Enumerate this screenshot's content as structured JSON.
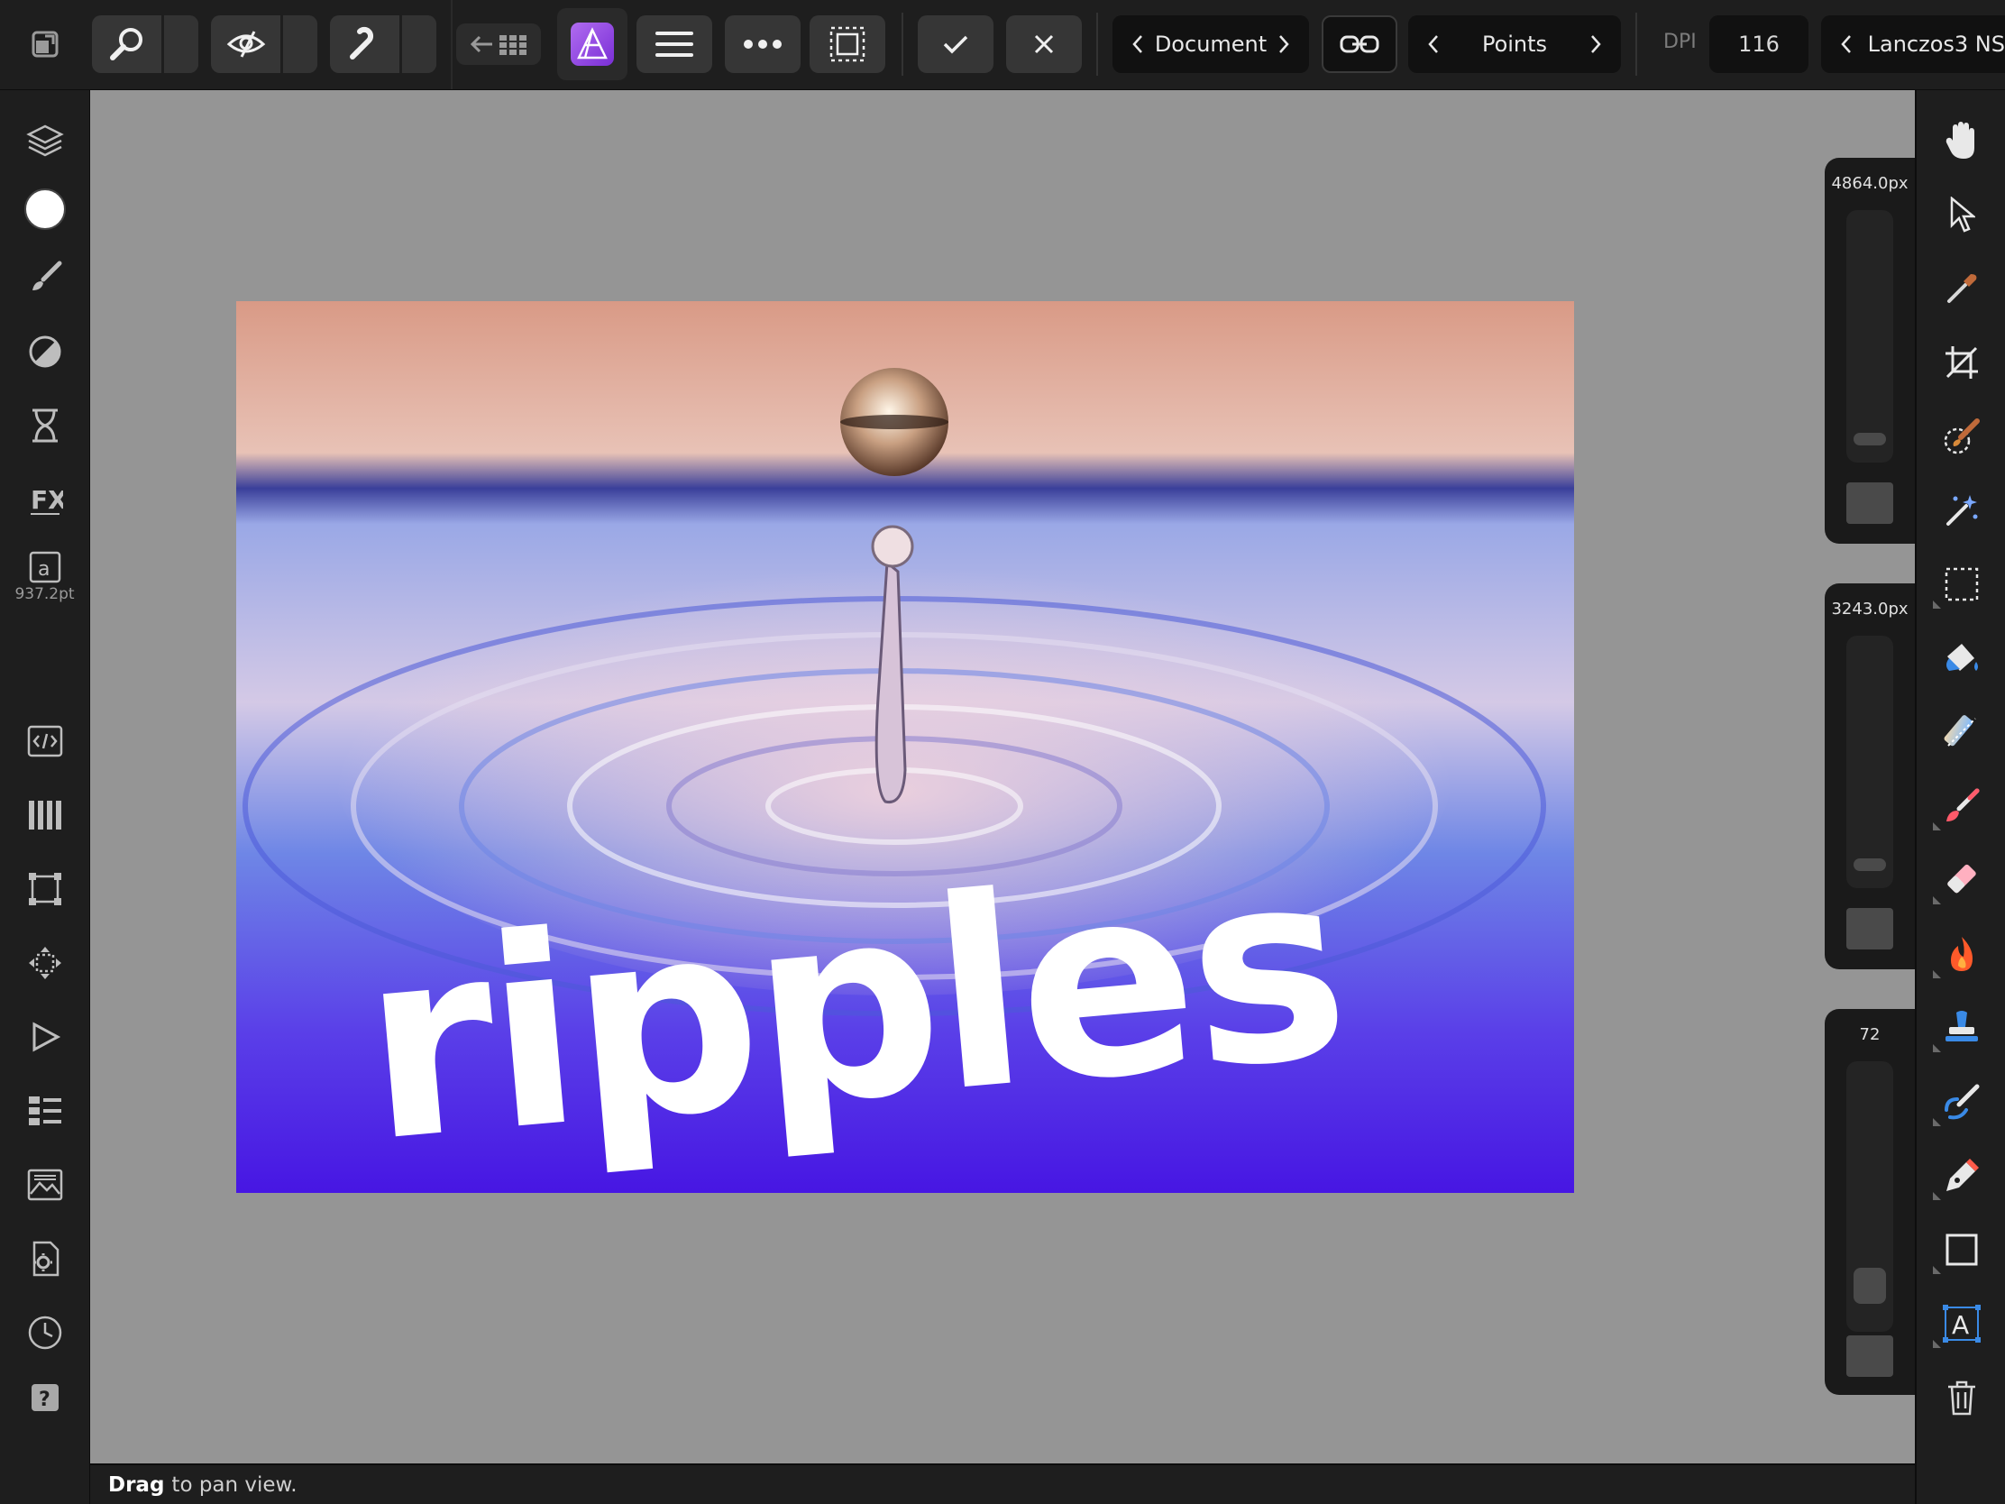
{
  "toolbar": {
    "unit_scope": "Document",
    "units": "Points",
    "dpi_label": "DPI",
    "dpi_value": "116",
    "resample": "Lanczos3 NS"
  },
  "left_sidebar": {
    "text_size": "937.2pt"
  },
  "document": {
    "art_text": "ripples",
    "colors": {
      "sky_top": "#d99a86",
      "sky_bottom": "#e8c2b6",
      "water_mid": "#6e86e6",
      "water_deep": "#4716e3",
      "text": "#ffffff"
    }
  },
  "sliders": [
    {
      "value": "4864.0px",
      "level": 0.05
    },
    {
      "value": "3243.0px",
      "level": 0.05
    },
    {
      "value": "72",
      "level": 0.1
    }
  ],
  "status_bar": {
    "action": "Drag",
    "text": "to pan view."
  },
  "icons": {
    "top": [
      "view-mode-icon",
      "zoom-icon",
      "eye-icon",
      "snap-icon",
      "back-to-gallery-icon",
      "affinity-photo-icon",
      "menu-icon",
      "more-icon",
      "selection-icon",
      "apply-icon",
      "cancel-icon",
      "link-icon"
    ],
    "left": [
      "layers-icon",
      "color-icon",
      "brushes-icon",
      "adjustments-icon",
      "history-icon",
      "fx-icon",
      "text-icon",
      "macro-icon",
      "channels-icon",
      "transform-icon",
      "navigator-icon",
      "play-icon",
      "stock-icon",
      "image-icon",
      "settings-icon",
      "clock-icon",
      "help-icon"
    ],
    "right": [
      "hand-icon",
      "pointer-icon",
      "color-picker-icon",
      "crop-icon",
      "selection-brush-icon",
      "magic-wand-icon",
      "marquee-icon",
      "flood-fill-icon",
      "gradient-icon",
      "paint-brush-icon",
      "eraser-icon",
      "burn-icon",
      "clone-stamp-icon",
      "smudge-icon",
      "pen-icon",
      "rectangle-icon",
      "text-tool-icon",
      "trash-icon"
    ]
  }
}
